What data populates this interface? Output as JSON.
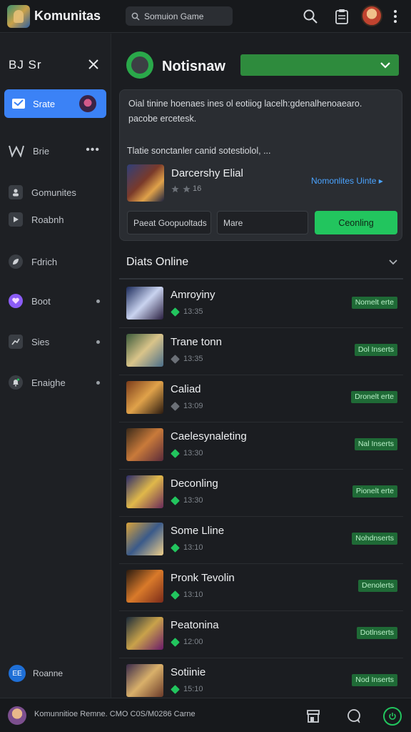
{
  "app": {
    "title": "Komunitas",
    "search_placeholder": "Somuion Game",
    "accent": "#3b82f6",
    "green": "#22c55e"
  },
  "sidebar": {
    "header_label": "BJ Sr",
    "active_item": "Srate",
    "items": [
      {
        "label": "Brie",
        "icon": "grid-icon",
        "trailing": "more"
      },
      {
        "label": "Gomunites",
        "icon": "user-icon",
        "trailing": ""
      },
      {
        "label": "Roabnh",
        "icon": "play-icon",
        "trailing": ""
      },
      {
        "label": "Fdrich",
        "icon": "leaf-icon",
        "trailing": ""
      },
      {
        "label": "Boot",
        "icon": "heart-icon",
        "trailing": "dot"
      },
      {
        "label": "Sies",
        "icon": "chart-icon",
        "trailing": "dot"
      },
      {
        "label": "Enaighe",
        "icon": "bell-icon",
        "trailing": "dot"
      }
    ],
    "footer_badge": "EE",
    "footer_label": "Roanne"
  },
  "main": {
    "group_title": "Notisnaw",
    "card": {
      "description": "Oial tinine hoenaes ines ol eotiiog lacelh:gdenalhenoaearo. pacobe ercetesk.",
      "subtext": "Tlatie sonctanler canid sotestiolol, ...",
      "featured_title": "Darcershy Elial",
      "featured_meta": "16",
      "featured_link": "Nomonlites Uinte",
      "button_1": "Paeat Goopuoltads",
      "button_2_placeholder": "Mare",
      "button_3": "Ceonling"
    },
    "section_title": "Diats Online",
    "games": [
      {
        "name": "Amroyiny",
        "time": "13:35",
        "badge": "Nomelt erte",
        "active": true,
        "thumb": [
          "#1b2a5a",
          "#c9d3ef",
          "#2a1f40"
        ]
      },
      {
        "name": "Trane tonn",
        "time": "13:35",
        "badge": "Dol Inserts",
        "active": false,
        "thumb": [
          "#3b5a3a",
          "#d9c48a",
          "#4a6e8a"
        ]
      },
      {
        "name": "Caliad",
        "time": "13:09",
        "badge": "Dronelt erte",
        "active": false,
        "thumb": [
          "#7a3b1a",
          "#e0a24a",
          "#2a1a10"
        ]
      },
      {
        "name": "Caelesynaleting",
        "time": "13:30",
        "badge": "Nal Inserts",
        "active": true,
        "thumb": [
          "#3a2a1a",
          "#c97a3a",
          "#5a2a3a"
        ]
      },
      {
        "name": "Deconling",
        "time": "13:30",
        "badge": "Pionelt erte",
        "active": true,
        "thumb": [
          "#2a2a6a",
          "#e0b84a",
          "#6a2a5a"
        ]
      },
      {
        "name": "Some Lline",
        "time": "13:10",
        "badge": "Nohdnserts",
        "active": true,
        "thumb": [
          "#d9a23a",
          "#3a5a8a",
          "#f0d08a"
        ]
      },
      {
        "name": "Pronk Tevolin",
        "time": "13:10",
        "badge": "Denolerts",
        "active": true,
        "thumb": [
          "#2a1a10",
          "#d97a2a",
          "#7a2a1a"
        ]
      },
      {
        "name": "Peatonina",
        "time": "12:00",
        "badge": "Dotlnserts",
        "active": true,
        "thumb": [
          "#1a2a3a",
          "#c9a24a",
          "#6a1a6a"
        ]
      },
      {
        "name": "Sotiinie",
        "time": "15:10",
        "badge": "Nod Inserts",
        "active": true,
        "thumb": [
          "#3a2a4a",
          "#d9b06a",
          "#6a3a2a"
        ]
      }
    ]
  },
  "bottombar": {
    "status_text": "Komunnitioe Remne. CMO C0S/M0286 Carne"
  }
}
